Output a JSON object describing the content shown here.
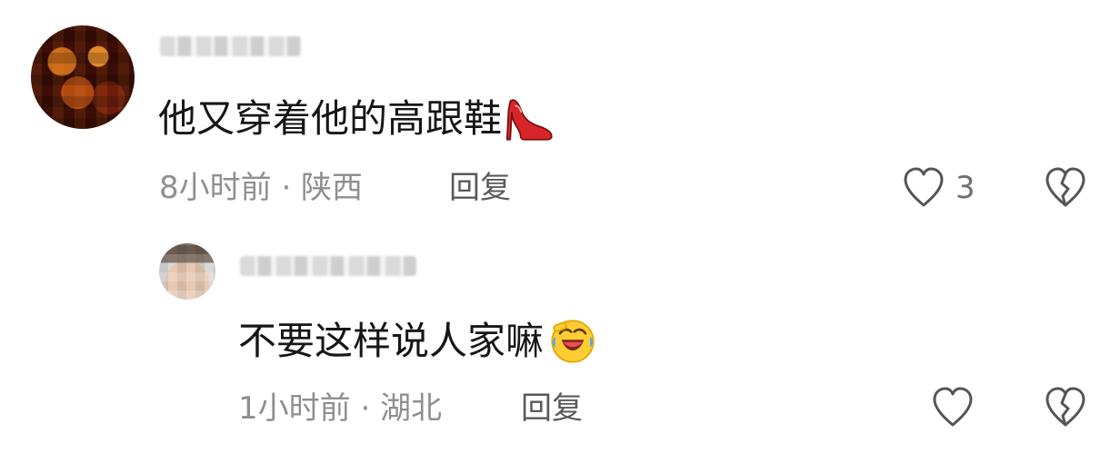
{
  "comment": {
    "text": "他又穿着他的高跟鞋",
    "emoji": "high-heel-shoe",
    "meta": "8小时前 · 陕西",
    "reply_label": "回复",
    "like_count": "3"
  },
  "reply": {
    "text": "不要这样说人家嘛",
    "emoji": "rolling-on-floor-laughing",
    "meta": "1小时前 · 湖北",
    "reply_label": "回复"
  },
  "colors": {
    "text_primary": "#161616",
    "text_meta": "#8f8f8f",
    "text_reply": "#5a5a5a",
    "icon_stroke": "#555555",
    "heel_red": "#d7262a"
  }
}
